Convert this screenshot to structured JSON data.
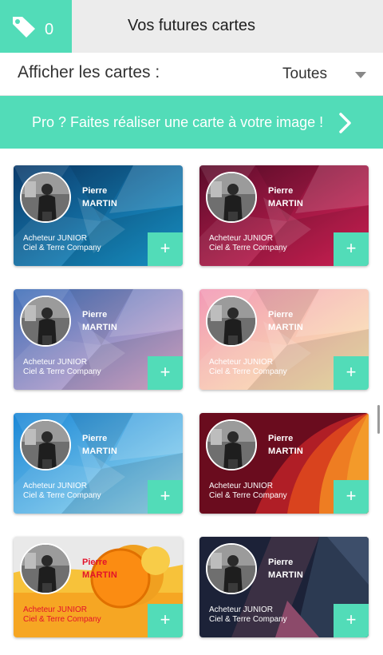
{
  "header": {
    "tag_count": "0",
    "title": "Vos futures cartes"
  },
  "filter": {
    "label": "Afficher les cartes :",
    "value": "Toutes"
  },
  "banner": {
    "text": "Pro ? Faites réaliser une carte à votre image !"
  },
  "cards": [
    {
      "first": "Pierre",
      "last": "MARTIN",
      "job": "Acheteur JUNIOR",
      "company": "Ciel & Terre Company",
      "add": "+",
      "theme": "blue-poly",
      "colors": [
        "#0b3a6a",
        "#1aa0d8"
      ]
    },
    {
      "first": "Pierre",
      "last": "MARTIN",
      "job": "Acheteur JUNIOR",
      "company": "Ciel & Terre Company",
      "add": "+",
      "theme": "red-poly",
      "colors": [
        "#5a0c2a",
        "#e3245c"
      ]
    },
    {
      "first": "Pierre",
      "last": "MARTIN",
      "job": "Acheteur JUNIOR",
      "company": "Ciel & Terre Company",
      "add": "+",
      "theme": "pastel-poly",
      "colors": [
        "#3f6fb8",
        "#e7b2d4"
      ]
    },
    {
      "first": "Pierre",
      "last": "MARTIN",
      "job": "Acheteur JUNIOR",
      "company": "Ciel & Terre Company",
      "add": "+",
      "theme": "peach-poly",
      "colors": [
        "#f29ab6",
        "#fdf0b0"
      ]
    },
    {
      "first": "Pierre",
      "last": "MARTIN",
      "job": "Acheteur JUNIOR",
      "company": "Ciel & Terre Company",
      "add": "+",
      "theme": "sky-poly",
      "colors": [
        "#1b87d6",
        "#9fe0f4"
      ]
    },
    {
      "first": "Pierre",
      "last": "MARTIN",
      "job": "Acheteur JUNIOR",
      "company": "Ciel & Terre Company",
      "add": "+",
      "theme": "sunset-arcs",
      "colors": [
        "#6a0c1e",
        "#f39a2a"
      ]
    },
    {
      "first": "Pierre",
      "last": "MARTIN",
      "job": "Acheteur JUNIOR",
      "company": "Ciel & Terre Company",
      "add": "+",
      "theme": "orange-circles",
      "colors": [
        "#e9e9e9",
        "#f6a623"
      ],
      "text_color": "#e3122b"
    },
    {
      "first": "Pierre",
      "last": "MARTIN",
      "job": "Acheteur JUNIOR",
      "company": "Ciel & Terre Company",
      "add": "+",
      "theme": "dark-geo",
      "colors": [
        "#1c2238",
        "#4b2f4a"
      ]
    }
  ],
  "colors": {
    "accent": "#52dcb8",
    "topbar": "#ececec"
  }
}
